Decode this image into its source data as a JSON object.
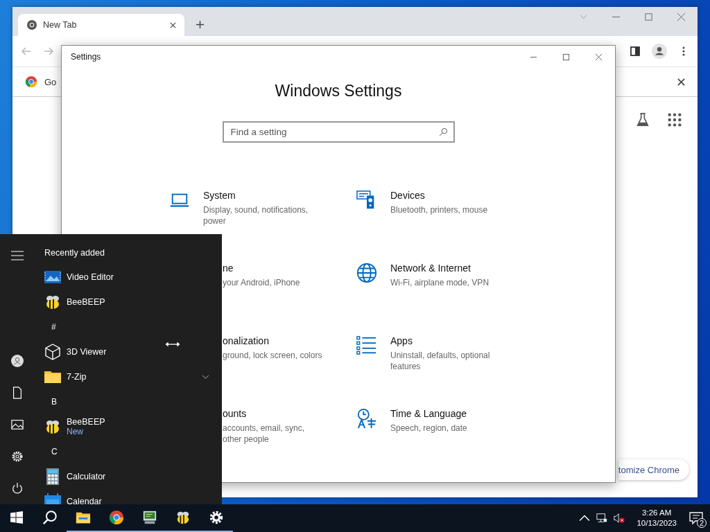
{
  "browser": {
    "tabs": [
      {
        "title": "New Tab",
        "selected": true
      }
    ],
    "infobar": {
      "text": "Go"
    },
    "customize_button": "tomize Chrome"
  },
  "settings_window": {
    "title": "Settings",
    "heading": "Windows Settings",
    "search": {
      "placeholder": "Find a setting"
    },
    "categories": [
      {
        "kind": "full",
        "name": "System",
        "description": [
          "Display, sound, notifications,",
          "power"
        ]
      },
      {
        "kind": "full",
        "name": "Devices",
        "description": [
          "Bluetooth, printers, mouse"
        ]
      },
      {
        "kind": "covered",
        "name": "ne",
        "description": [
          "your Android, iPhone"
        ]
      },
      {
        "kind": "full",
        "name": "Network & Internet",
        "description": [
          "Wi-Fi, airplane mode, VPN"
        ]
      },
      {
        "kind": "covered",
        "name": "onalization",
        "description": [
          "ground, lock screen, colors"
        ]
      },
      {
        "kind": "full",
        "name": "Apps",
        "description": [
          "Uninstall, defaults, optional",
          "features"
        ]
      },
      {
        "kind": "covered",
        "name": "ounts",
        "description": [
          "accounts, email, sync,",
          "other people"
        ]
      },
      {
        "kind": "full",
        "name": "Time & Language",
        "description": [
          "Speech, region, date"
        ]
      }
    ]
  },
  "start_menu": {
    "section_title": "Recently added",
    "entries": [
      {
        "kind": "app",
        "label": "Video Editor"
      },
      {
        "kind": "app",
        "label": "BeeBEEP"
      },
      {
        "kind": "header",
        "label": "#"
      },
      {
        "kind": "app",
        "label": "3D Viewer"
      },
      {
        "kind": "app",
        "label": "7-Zip",
        "has_submenu": true
      },
      {
        "kind": "header",
        "label": "B"
      },
      {
        "kind": "app",
        "label": "BeeBEEP",
        "badge": "New"
      },
      {
        "kind": "header",
        "label": "C"
      },
      {
        "kind": "app",
        "label": "Calculator"
      },
      {
        "kind": "app",
        "label": "Calendar"
      }
    ]
  },
  "taskbar": {
    "apps": [
      {
        "running": true
      },
      {
        "running": true
      },
      {
        "running": true
      },
      {
        "running": true
      },
      {
        "running": true
      }
    ],
    "clock": {
      "time": "3:26 AM",
      "date": "10/13/2023"
    },
    "notifications": "2"
  }
}
